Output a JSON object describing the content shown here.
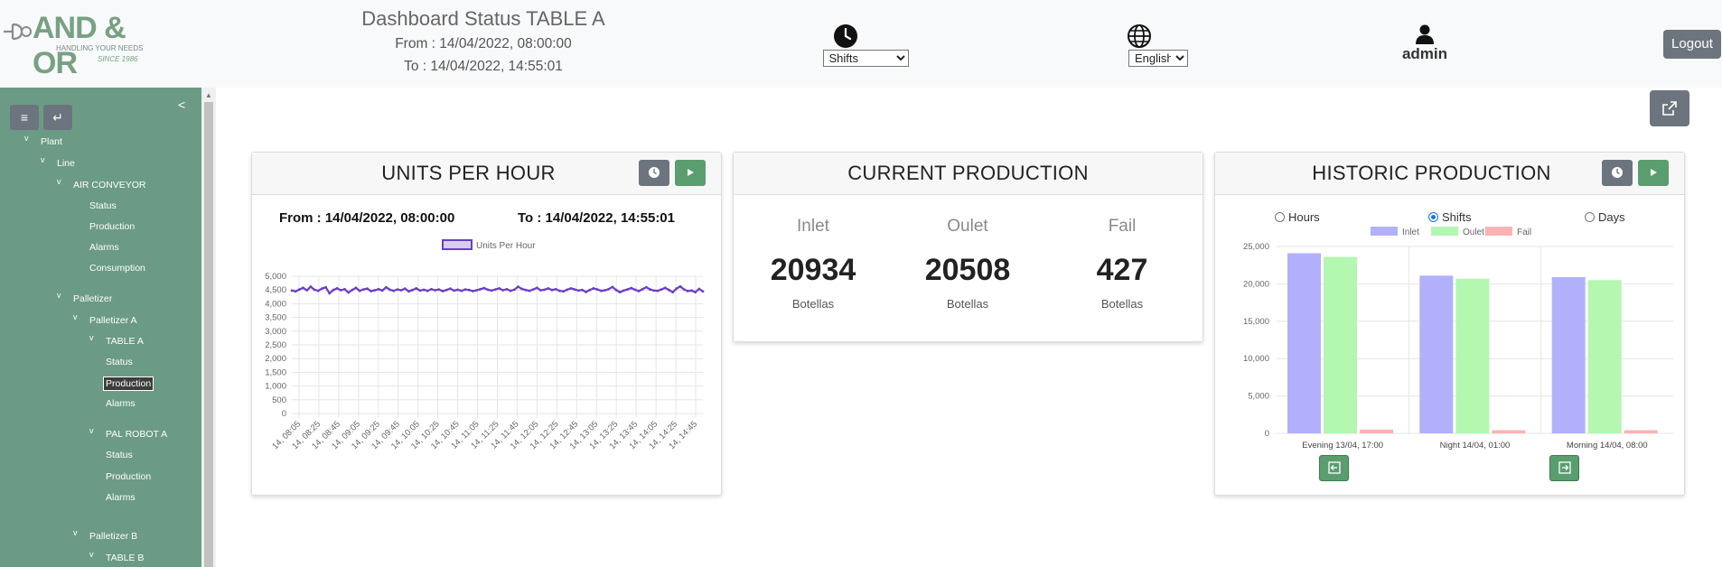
{
  "header": {
    "logo": {
      "text": "AND & OR",
      "tagline": "HANDLING YOUR NEEDS",
      "since": "SINCE 1986"
    },
    "title": "Dashboard Status TABLE A",
    "from": "From : 14/04/2022, 08:00:00",
    "to": "To : 14/04/2022, 14:55:01",
    "period_select": "Shifts",
    "language_select": "English",
    "user": "admin",
    "logout": "Logout"
  },
  "sidebar": {
    "collapse": "<",
    "menu_icon": "≡",
    "back_icon": "↵",
    "tree": [
      {
        "label": "Plant",
        "level": 0
      },
      {
        "label": "Line",
        "level": 1
      },
      {
        "label": "AIR CONVEYOR",
        "level": 2
      },
      {
        "label": "Status",
        "level": 3
      },
      {
        "label": "Production",
        "level": 3
      },
      {
        "label": "Alarms",
        "level": 3
      },
      {
        "label": "Consumption",
        "level": 3
      },
      {
        "label": "Palletizer",
        "level": 2
      },
      {
        "label": "Palletizer A",
        "level": 3
      },
      {
        "label": "TABLE A",
        "level": 4
      },
      {
        "label": "Status",
        "level": 5
      },
      {
        "label": "Production",
        "level": 5,
        "active": true
      },
      {
        "label": "Alarms",
        "level": 5
      },
      {
        "label": "PAL ROBOT A",
        "level": 4
      },
      {
        "label": "Status",
        "level": 5
      },
      {
        "label": "Production",
        "level": 5
      },
      {
        "label": "Alarms",
        "level": 5
      },
      {
        "label": "Palletizer B",
        "level": 3
      },
      {
        "label": "TABLE B",
        "level": 4
      }
    ]
  },
  "units_card": {
    "title": "UNITS PER HOUR",
    "from": "From : 14/04/2022, 08:00:00",
    "to": "To : 14/04/2022, 14:55:01"
  },
  "current_card": {
    "title": "CURRENT PRODUCTION",
    "cols": [
      {
        "label": "Inlet",
        "value": "20934",
        "unit": "Botellas"
      },
      {
        "label": "Oulet",
        "value": "20508",
        "unit": "Botellas"
      },
      {
        "label": "Fail",
        "value": "427",
        "unit": "Botellas"
      }
    ]
  },
  "historic_card": {
    "title": "HISTORIC PRODUCTION",
    "radios": [
      {
        "label": "Hours",
        "checked": false
      },
      {
        "label": "Shifts",
        "checked": true
      },
      {
        "label": "Days",
        "checked": false
      }
    ]
  },
  "colors": {
    "sidebar": "#6b9b84",
    "line": "#6a3fc4",
    "inlet": "#b3b0fb",
    "oulet": "#b3f7b0",
    "fail": "#fdb3b3"
  },
  "chart_data": [
    {
      "type": "line",
      "legend": [
        "Units Per Hour"
      ],
      "ylim": [
        0,
        5000
      ],
      "yticks": [
        "5,000",
        "4,500",
        "4,000",
        "3,500",
        "3,000",
        "2,500",
        "2,000",
        "1,500",
        "1,000",
        "500",
        "0"
      ],
      "xticklabels": [
        "14, 08:05",
        "14, 08:25",
        "14, 08:45",
        "14, 09:05",
        "14, 09:25",
        "14, 09:45",
        "14, 10:05",
        "14, 10:25",
        "14, 10:45",
        "14, 11:05",
        "14, 11:25",
        "14, 11:45",
        "14, 12:05",
        "14, 12:25",
        "14, 12:45",
        "14, 13:05",
        "14, 13:25",
        "14, 13:45",
        "14, 14:05",
        "14, 14:25",
        "14, 14:45"
      ],
      "series": [
        {
          "name": "Units Per Hour",
          "values": [
            4480,
            4450,
            4520,
            4580,
            4490,
            4620,
            4510,
            4470,
            4550,
            4600,
            4380,
            4500,
            4560,
            4490,
            4530,
            4410,
            4500,
            4580,
            4470,
            4520,
            4550,
            4460,
            4490,
            4530,
            4480,
            4600,
            4510,
            4470,
            4520,
            4490,
            4550,
            4450,
            4500,
            4560,
            4480,
            4510,
            4470,
            4530,
            4490,
            4520,
            4460,
            4500,
            4550,
            4480,
            4510,
            4470,
            4520,
            4500,
            4460,
            4490,
            4530,
            4570,
            4510,
            4480,
            4520,
            4560,
            4490,
            4530,
            4470,
            4510,
            4620,
            4540,
            4500,
            4470,
            4520,
            4580,
            4490,
            4510,
            4560,
            4500,
            4530,
            4470,
            4450,
            4510,
            4560,
            4520,
            4480,
            4500,
            4430,
            4500,
            4560,
            4520,
            4470,
            4490,
            4530,
            4610,
            4500,
            4420,
            4480,
            4520,
            4570,
            4510,
            4460,
            4530,
            4600,
            4520,
            4480,
            4470,
            4520,
            4580,
            4500,
            4420,
            4550,
            4630,
            4520,
            4460,
            4480,
            4420,
            4540,
            4450
          ]
        }
      ]
    },
    {
      "type": "bar",
      "categories": [
        "Evening  13/04, 17:00",
        "Night  14/04, 01:00",
        "Morning  14/04, 08:00"
      ],
      "ylim": [
        0,
        25000
      ],
      "yticks": [
        "25,000",
        "20,000",
        "15,000",
        "10,000",
        "5,000",
        "0"
      ],
      "series": [
        {
          "name": "Inlet",
          "values": [
            24100,
            21100,
            20900
          ]
        },
        {
          "name": "Oulet",
          "values": [
            23600,
            20700,
            20500
          ]
        },
        {
          "name": "Fail",
          "values": [
            500,
            420,
            420
          ]
        }
      ]
    }
  ]
}
